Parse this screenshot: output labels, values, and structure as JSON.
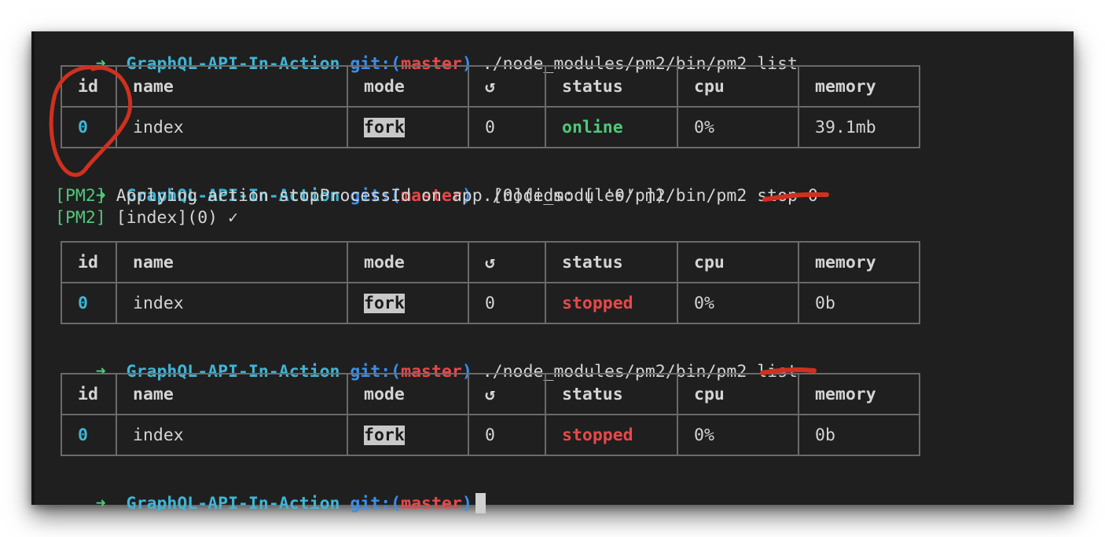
{
  "prompt": {
    "arrow": "➜",
    "directory": "GraphQL-API-In-Action",
    "git_prefix": "git:(",
    "branch": "master",
    "git_suffix": ")"
  },
  "commands": [
    "./node_modules/pm2/bin/pm2 list",
    "./node_modules/pm2/bin/pm2 stop 0",
    "./node_modules/pm2/bin/pm2 list"
  ],
  "pm2_output": [
    {
      "tag": "[PM2]",
      "text": "Applying action stopProcessId on app [0](ids: [ '0' ])"
    },
    {
      "tag": "[PM2]",
      "text": "[index](0) ✓"
    }
  ],
  "table_headers": [
    "id",
    "name",
    "mode",
    "↺",
    "status",
    "cpu",
    "memory"
  ],
  "tables": [
    {
      "id": "0",
      "name": "index",
      "mode": "fork",
      "restarts": "0",
      "status": "online",
      "cpu": "0%",
      "memory": "39.1mb"
    },
    {
      "id": "0",
      "name": "index",
      "mode": "fork",
      "restarts": "0",
      "status": "stopped",
      "cpu": "0%",
      "memory": "0b"
    },
    {
      "id": "0",
      "name": "index",
      "mode": "fork",
      "restarts": "0",
      "status": "stopped",
      "cpu": "0%",
      "memory": "0b"
    }
  ],
  "colors": {
    "background": "#1f1f1f",
    "prompt_arrow": "#4ec97a",
    "directory": "#3fb5d6",
    "git": "#3b8eea",
    "branch": "#e84848",
    "status_online": "#4ec97a",
    "status_stopped": "#e84848",
    "annotation": "#d03020"
  }
}
